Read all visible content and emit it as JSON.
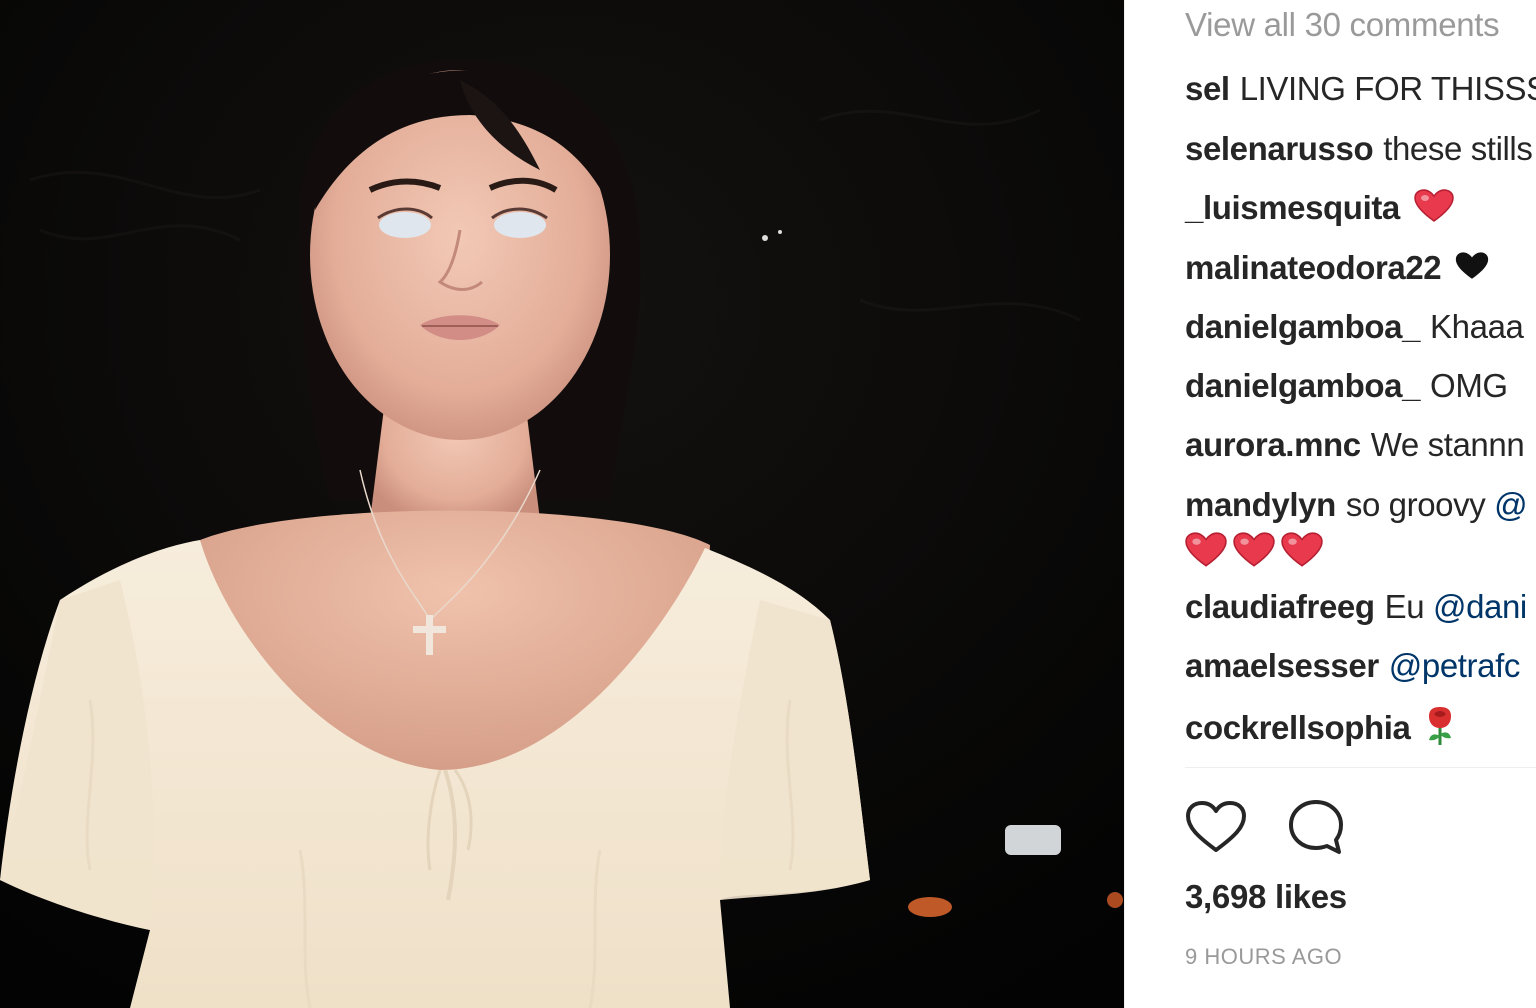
{
  "post": {
    "view_all_comments": "View all 30 comments",
    "likes": "3,698 likes",
    "timestamp": "9 HOURS AGO"
  },
  "comments": [
    {
      "user": "sel",
      "text": "LIVING FOR THISSS"
    },
    {
      "user": "selenarusso",
      "text": "these stills"
    },
    {
      "user": "_luismesquita",
      "text": "",
      "emoji": "red-heart"
    },
    {
      "user": "malinateodora22",
      "text": "",
      "emoji": "black-heart"
    },
    {
      "user": "danielgamboa_",
      "text": "Khaaa"
    },
    {
      "user": "danielgamboa_",
      "text": "OMG"
    },
    {
      "user": "aurora.mnc",
      "text": "We stannn"
    },
    {
      "user": "mandylyn",
      "text": "so groovy",
      "mention": "@",
      "emoji_row": [
        "red-heart",
        "red-heart",
        "red-heart"
      ]
    },
    {
      "user": "claudiafreeg",
      "text": "Eu",
      "mention": "@dani"
    },
    {
      "user": "amaelsesser",
      "text": "",
      "mention": "@petrafc"
    },
    {
      "user": "cockrellsophia",
      "text": "",
      "emoji": "rose"
    }
  ],
  "icons": [
    "like-heart-icon",
    "comment-bubble-icon"
  ],
  "colors": {
    "text": "#262626",
    "muted": "#9a9a9a",
    "mention": "#003569",
    "heart": "#e8394d",
    "photo_bg": "#050505"
  }
}
